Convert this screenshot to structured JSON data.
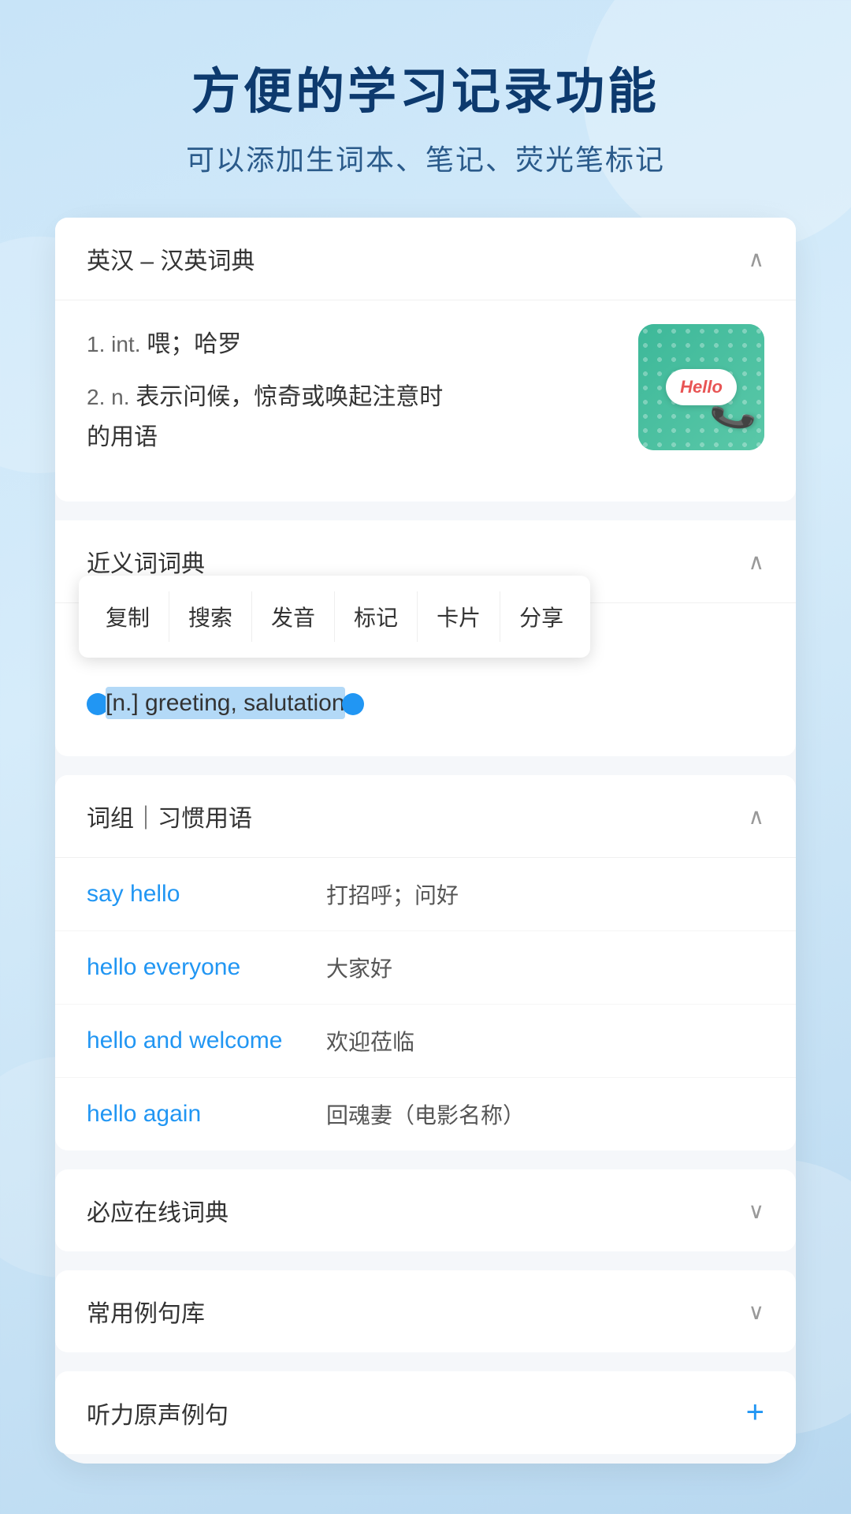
{
  "header": {
    "title": "方便的学习记录功能",
    "subtitle": "可以添加生词本、笔记、荧光笔标记"
  },
  "english_chinese_dict": {
    "section_title": "英汉 – 汉英词典",
    "chevron": "∧",
    "definitions": [
      {
        "number": "1.",
        "part_of_speech": "int.",
        "text": "喂；哈罗"
      },
      {
        "number": "2.",
        "part_of_speech": "n.",
        "text": "表示问候，惊奇或唤起注意时的用语"
      }
    ],
    "image_text": "Hello"
  },
  "synonym_dict": {
    "section_title": "近义词词典",
    "chevron": "∧",
    "context_menu": {
      "items": [
        "复制",
        "搜索",
        "发音",
        "标记",
        "卡片",
        "分享"
      ]
    },
    "highlighted_text": "[n.] greeting, salutation"
  },
  "phrases": {
    "section_title": "词组｜习惯用语",
    "chevron": "∧",
    "items": [
      {
        "english": "say hello",
        "chinese": "打招呼；问好"
      },
      {
        "english": "hello everyone",
        "chinese": "大家好"
      },
      {
        "english": "hello and welcome",
        "chinese": "欢迎莅临"
      },
      {
        "english": "hello again",
        "chinese": "回魂妻（电影名称）"
      }
    ]
  },
  "biying_dict": {
    "section_title": "必应在线词典",
    "chevron": "∨"
  },
  "example_sentences": {
    "section_title": "常用例句库",
    "chevron": "∨"
  },
  "audio_examples": {
    "section_title": "听力原声例句",
    "plus_icon": "+"
  }
}
